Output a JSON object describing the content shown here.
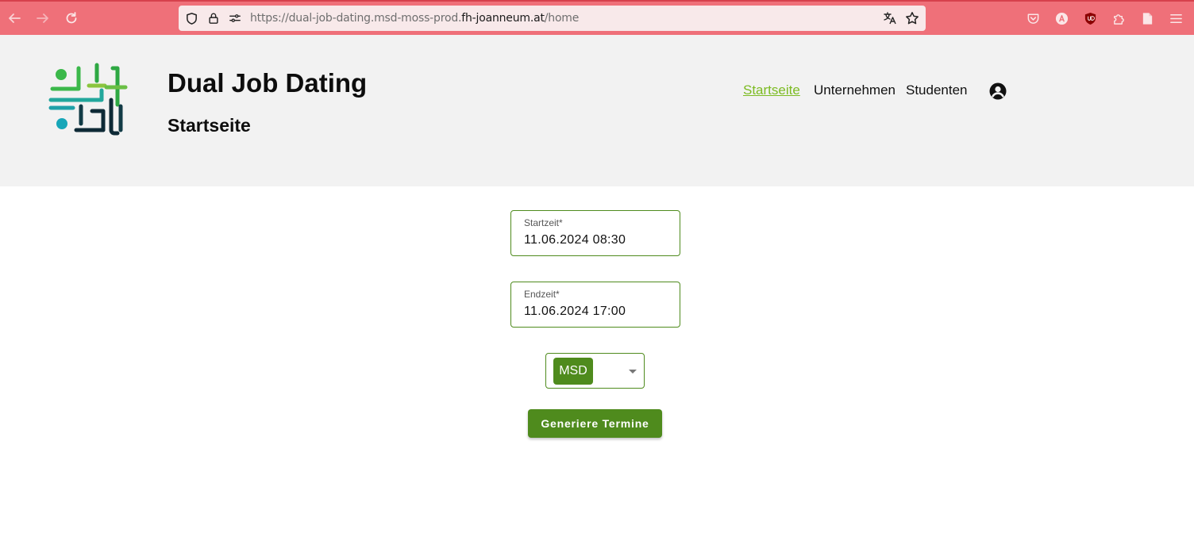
{
  "browser": {
    "url_prefix": "https://dual-job-dating.msd-moss-prod.",
    "url_host": "fh-joanneum.at",
    "url_path": "/home",
    "icons": [
      "back-arrow-icon",
      "forward-arrow-icon",
      "reload-icon",
      "shield-icon",
      "lock-icon",
      "permissions-icon",
      "translate-icon",
      "bookmark-star-icon",
      "pocket-icon",
      "account-icon",
      "ublock-icon",
      "extensions-icon",
      "reader-view-icon",
      "menu-icon"
    ],
    "colors": {
      "toolbar": "#ef7079",
      "url_bg": "#f8e9ea"
    }
  },
  "header": {
    "site_title": "Dual Job Dating",
    "page_title": "Startseite",
    "nav": [
      {
        "label": "Startseite",
        "active": true
      },
      {
        "label": "Unternehmen",
        "active": false
      },
      {
        "label": "Studenten",
        "active": false
      }
    ],
    "icons": [
      "logo-icon",
      "user-account-icon"
    ],
    "colors": {
      "active_link": "#7cbb22",
      "header_bg": "#f2f2f2"
    }
  },
  "form": {
    "start": {
      "label": "Startzeit*",
      "value": "11.06.2024 08:30"
    },
    "end": {
      "label": "Endzeit*",
      "value": "11.06.2024 17:00"
    },
    "program_select": {
      "selected": "MSD"
    },
    "submit_label": "Generiere Termine",
    "colors": {
      "accent": "#4f8b1d"
    }
  }
}
